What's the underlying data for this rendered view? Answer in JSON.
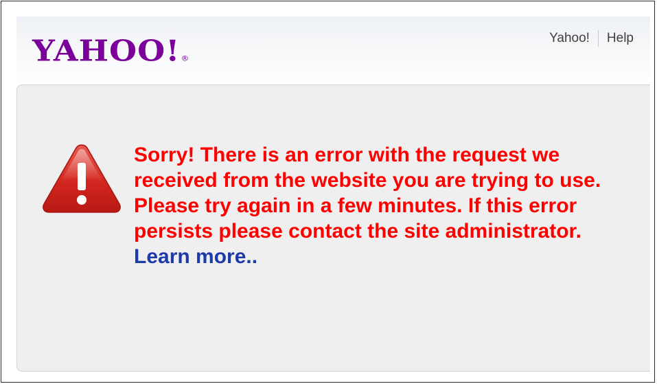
{
  "header": {
    "logo_text": "YAHOO!",
    "logo_mark": "®",
    "links": [
      {
        "label": "Yahoo!"
      },
      {
        "label": "Help"
      }
    ]
  },
  "error": {
    "icon": "warning-triangle-icon",
    "message": "Sorry! There is an error with the request we received from the website you are trying to use. Please try again in a few minutes. If this error persists please contact the site administrator.",
    "learn_more": "Learn more.."
  },
  "colors": {
    "brand": "#7b0099",
    "error_text": "#ff0000",
    "link": "#1e3aa8",
    "panel_bg": "#efefef",
    "icon_red": "#d2261f"
  }
}
